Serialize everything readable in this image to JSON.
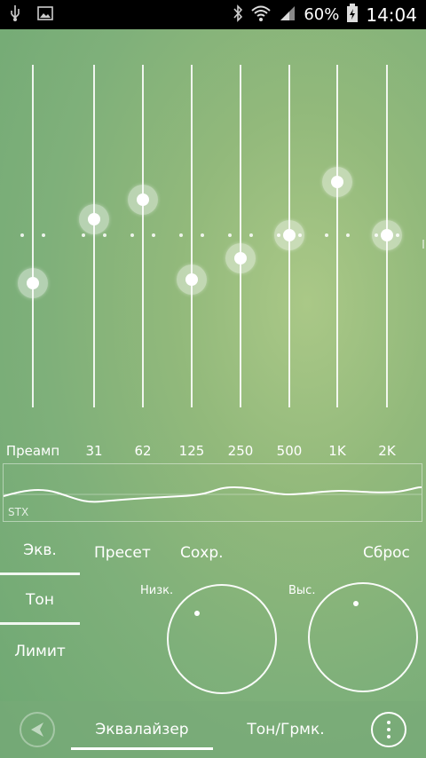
{
  "status_bar": {
    "battery": "60%",
    "time": "14:04",
    "icons": [
      "usb-icon",
      "image-icon",
      "bluetooth-icon",
      "wifi-icon",
      "signal-icon",
      "battery-icon"
    ]
  },
  "equalizer": {
    "bands": [
      {
        "label": "Преамп",
        "level": -0.27
      },
      {
        "label": "31",
        "level": 0.09
      },
      {
        "label": "62",
        "level": 0.2
      },
      {
        "label": "125",
        "level": -0.25
      },
      {
        "label": "250",
        "level": -0.13
      },
      {
        "label": "500",
        "level": 0.0
      },
      {
        "label": "1K",
        "level": 0.3
      },
      {
        "label": "2K",
        "level": 0.0
      }
    ],
    "curve_label": "STX"
  },
  "toolbar": {
    "preset": "Пресет",
    "save": "Сохр.",
    "reset": "Сброс"
  },
  "side_tabs": [
    {
      "label": "Экв.",
      "active": true
    },
    {
      "label": "Тон",
      "active": true
    },
    {
      "label": "Лимит",
      "active": false
    }
  ],
  "tone": {
    "low_label": "Низк.",
    "high_label": "Выс."
  },
  "bottom_bar": {
    "tab_eq": "Эквалайзер",
    "tab_tone": "Тон/Грмк."
  },
  "colors": {
    "status_bar_bg": "#000000",
    "accent": "#ffffff"
  }
}
